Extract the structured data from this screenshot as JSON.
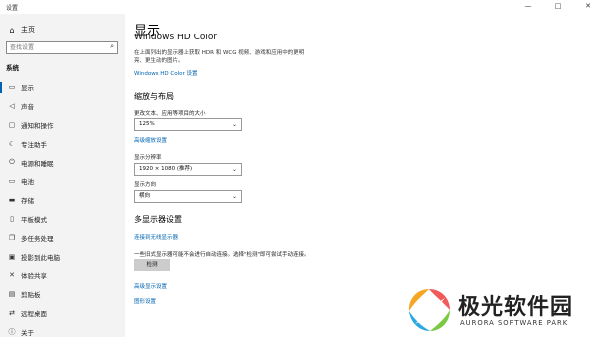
{
  "window": {
    "title": "设置",
    "controls": {
      "minimize": "—",
      "maximize": "□",
      "close": "✕"
    }
  },
  "sidebar": {
    "home": {
      "icon": "home-icon",
      "label": "主页"
    },
    "search": {
      "placeholder": "查找设置",
      "icon": "search-icon"
    },
    "section_label": "系统",
    "items": [
      {
        "icon": "monitor-icon",
        "label": "显示",
        "active": true
      },
      {
        "icon": "speaker-icon",
        "label": "声音"
      },
      {
        "icon": "notification-icon",
        "label": "通知和操作"
      },
      {
        "icon": "moon-icon",
        "label": "专注助手"
      },
      {
        "icon": "power-icon",
        "label": "电源和睡眠"
      },
      {
        "icon": "battery-icon",
        "label": "电池"
      },
      {
        "icon": "storage-icon",
        "label": "存储"
      },
      {
        "icon": "tablet-icon",
        "label": "平板模式"
      },
      {
        "icon": "multitask-icon",
        "label": "多任务处理"
      },
      {
        "icon": "project-icon",
        "label": "投影到此电脑"
      },
      {
        "icon": "share-icon",
        "label": "体验共享"
      },
      {
        "icon": "clipboard-icon",
        "label": "剪贴板"
      },
      {
        "icon": "remote-icon",
        "label": "远程桌面"
      },
      {
        "icon": "info-icon",
        "label": "关于"
      }
    ]
  },
  "main": {
    "title": "显示",
    "hdr_heading": "Windows HD Color",
    "hdr_description": "在上面列出的显示器上获取 HDR 和 WCG 视频、游戏和应用中的更明亮、更生动的图片。",
    "hdr_link": "Windows HD Color 设置",
    "scale_section": "缩放与布局",
    "scale_label": "更改文本、应用等项目的大小",
    "scale_value": "125%",
    "advanced_scale_link": "高级缩放设置",
    "resolution_label": "显示分辨率",
    "resolution_value": "1920 × 1080 (推荐)",
    "orientation_label": "显示方向",
    "orientation_value": "横向",
    "multi_section": "多显示器设置",
    "wireless_link": "连接到无线显示器",
    "detect_description": "一些旧式显示器可能不会进行自动连接。选择\"检测\"即可尝试手动连接。",
    "detect_button": "检测",
    "advanced_display_link": "高级显示设置",
    "graphics_link": "图形设置"
  },
  "watermark": {
    "name": "极光软件园",
    "subtitle": "AURORA SOFTWARE PARK"
  }
}
